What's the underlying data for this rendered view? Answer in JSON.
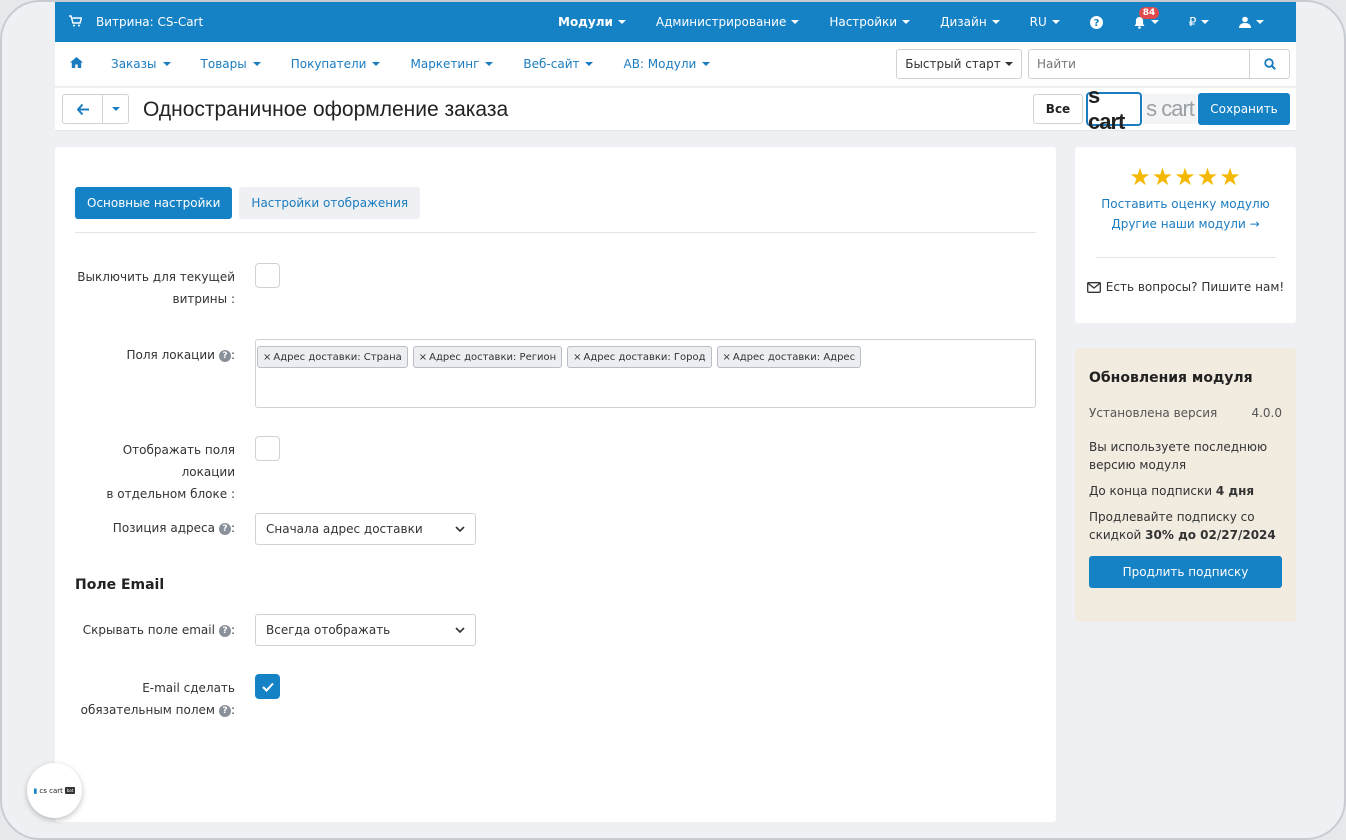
{
  "topbar": {
    "store": "Витрина: CS-Cart",
    "nav": [
      {
        "label": "Модули",
        "bold": true
      },
      {
        "label": "Администрирование"
      },
      {
        "label": "Настройки"
      },
      {
        "label": "Дизайн"
      },
      {
        "label": "RU"
      }
    ],
    "notifications_count": "84",
    "currency": "₽"
  },
  "menubar": {
    "items": [
      "Заказы",
      "Товары",
      "Покупатели",
      "Маркетинг",
      "Веб-сайт",
      "АВ: Модули"
    ],
    "quick_start": "Быстрый старт",
    "search_placeholder": "Найти"
  },
  "titlebar": {
    "title": "Одностраничное оформление заказа",
    "all_label": "Все",
    "logo_active": "s cart",
    "logo_inactive": "s cart",
    "save_label": "Сохранить"
  },
  "tabs": [
    "Основные настройки",
    "Настройки отображения"
  ],
  "form": {
    "disable_label_1": "Выключить для текущей",
    "disable_label_2": "витрины :",
    "location_fields_label": "Поля локации",
    "location_tags": [
      "Адрес доставки: Страна",
      "Адрес доставки: Регион",
      "Адрес доставки: Город",
      "Адрес доставки: Адрес"
    ],
    "separate_block_label_1": "Отображать поля локации",
    "separate_block_label_2": "в отдельном блоке :",
    "address_position_label": "Позиция адреса",
    "address_position_value": "Сначала адрес доставки",
    "email_section": "Поле Email",
    "hide_email_label": "Скрывать поле email",
    "hide_email_value": "Всегда отображать",
    "email_required_label_1": "E-mail сделать",
    "email_required_label_2": "обязательным полем",
    "disable_checked": false,
    "separate_block_checked": false,
    "email_required_checked": true
  },
  "sidebar": {
    "rate_link": "Поставить оценку модулю",
    "other_modules_link": "Другие наши модули →",
    "contact": "Есть вопросы? Пишите нам!",
    "updates_title": "Обновления модуля",
    "installed_label": "Установлена версия",
    "installed_version": "4.0.0",
    "latest_text": "Вы используете последнюю версию модуля",
    "subscription_prefix": "До конца подписки",
    "subscription_days": "4 дня",
    "extend_prefix": "Продлевайте подписку со скидкой",
    "extend_bold": "30% до 02/27/2024",
    "renew_button": "Продлить подписку",
    "rating_stars": 5
  },
  "float_logo": {
    "text": "cs cart",
    "tag": "bot"
  },
  "colors": {
    "primary": "#1582c6",
    "link": "#1b7cc0",
    "star": "#f5b800",
    "updates_bg": "#f1ebe0"
  }
}
